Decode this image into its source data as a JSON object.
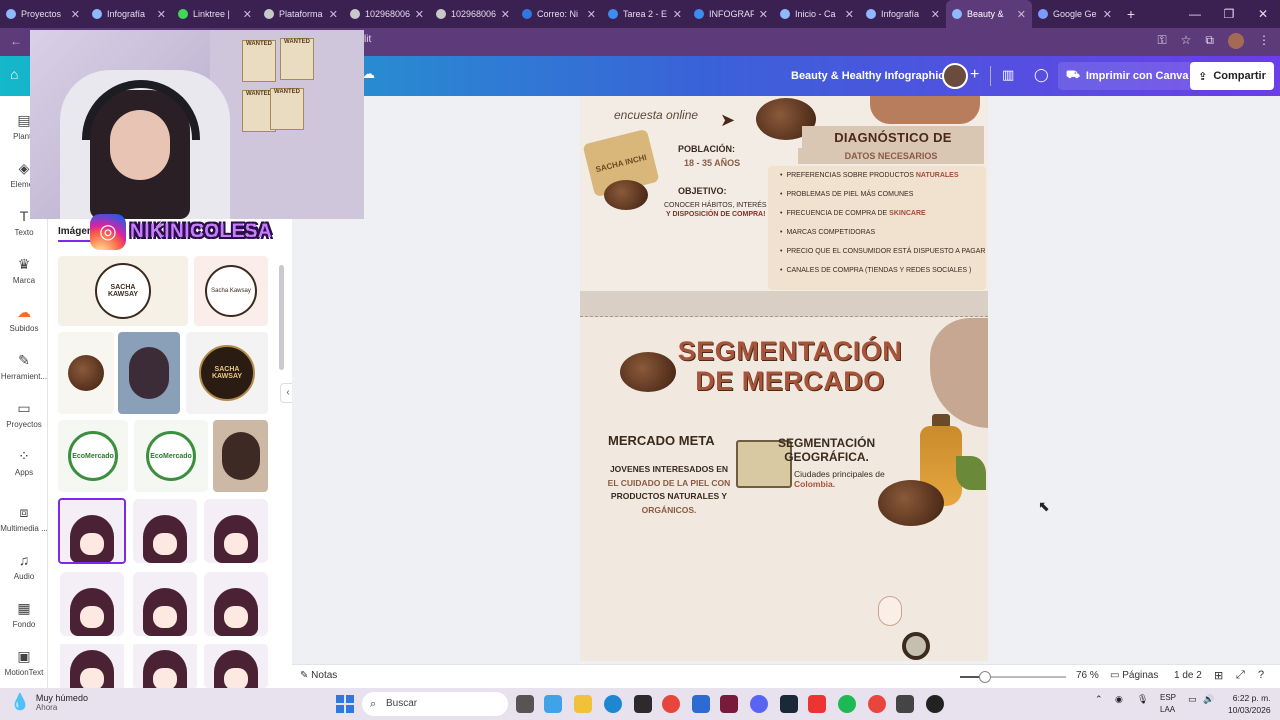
{
  "browser": {
    "tabs": [
      {
        "label": "Proyectos"
      },
      {
        "label": "Infografía"
      },
      {
        "label": "Linktree | "
      },
      {
        "label": "Plataforma"
      },
      {
        "label": "102968006"
      },
      {
        "label": "102968006"
      },
      {
        "label": "Correo: Ni"
      },
      {
        "label": "Tarea 2 - E"
      },
      {
        "label": "INFOGRAF"
      },
      {
        "label": "Inicio - Ca"
      },
      {
        "label": "Infografía"
      },
      {
        "label": "Beauty &"
      },
      {
        "label": "Google Ge"
      }
    ],
    "new_tab": "+",
    "address_fragment": "lit"
  },
  "canva": {
    "doc_title": "Beauty & Healthy Infographic",
    "print_button": "Imprimir con Canva",
    "share_button": "Compartir"
  },
  "rail": [
    {
      "label": "Plantil",
      "icon": "template-icon"
    },
    {
      "label": "Elemen",
      "icon": "elements-icon"
    },
    {
      "label": "Texto",
      "icon": "text-icon"
    },
    {
      "label": "Marca",
      "icon": "brand-icon"
    },
    {
      "label": "Subidos",
      "icon": "upload-icon"
    },
    {
      "label": "Herramient...",
      "icon": "tools-icon"
    },
    {
      "label": "Proyectos",
      "icon": "folder-icon"
    },
    {
      "label": "Apps",
      "icon": "apps-icon"
    },
    {
      "label": "Multimedia ...",
      "icon": "media-icon"
    },
    {
      "label": "Audio",
      "icon": "audio-icon"
    },
    {
      "label": "Fondo",
      "icon": "background-icon"
    },
    {
      "label": "MotionText",
      "icon": "motiontext-icon"
    }
  ],
  "panel": {
    "tab_images": "Imágen",
    "logos": {
      "sacha": "SACHA KAWSAY",
      "sacha_small": "Sacha Kawsay",
      "eco": "EcoMercado"
    }
  },
  "stream": {
    "instagram_handle": "NIKINICOLESA",
    "posters": [
      "WANTED",
      "WANTED",
      "WANTED",
      "WANTED"
    ]
  },
  "infographic": {
    "encuesta": "encuesta online",
    "diagnostico_title": "DIAGNÓSTICO DE MERCADO",
    "diagnostico_sub": "DATOS NECESARIOS",
    "poblacion_label": "POBLACIÓN:",
    "poblacion_value": "18 - 35 AÑOS",
    "objetivo_label": "OBJETIVO:",
    "objetivo_line1": "CONOCER HÁBITOS, INTERÉS",
    "objetivo_line2": "Y DISPOSICIÓN DE COMPRA!",
    "soap_text": "SACHA INCHI",
    "list": [
      {
        "text": "PREFERENCIAS SOBRE PRODUCTOS",
        "hl": "NATURALES"
      },
      {
        "text": "PROBLEMAS DE PIEL MÁS COMUNES",
        "hl": ""
      },
      {
        "text": "FRECUENCIA DE COMPRA DE",
        "hl": "SKINCARE"
      },
      {
        "text": "MARCAS COMPETIDORAS",
        "hl": ""
      },
      {
        "text": "PRECIO QUE EL CONSUMIDOR ESTÁ DISPUESTO A PAGAR",
        "hl": ""
      },
      {
        "text": "CANALES DE COMPRA (TIENDAS Y REDES SOCIALES )",
        "hl": ""
      }
    ],
    "seg_title_1": "SEGMENTACIÓN",
    "seg_title_2": "DE MERCADO",
    "meta_title": "MERCADO META",
    "meta_line1": "JOVENES INTERESADOS EN",
    "meta_line2": "EL CUIDADO DE LA PIEL CON",
    "meta_line3": "PRODUCTOS NATURALES Y",
    "meta_line4": "ORGÁNICOS.",
    "geo_title_1": "SEGMENTACIÓN",
    "geo_title_2": "GEOGRÁFICA.",
    "geo_line1": "Ciudades principales de",
    "geo_line2": "Colombia."
  },
  "statusbar": {
    "notes": "Notas",
    "zoom_percent": 76,
    "zoom_label": "76 %",
    "pages_label": "Páginas",
    "page_count": "1 de 2"
  },
  "taskbar": {
    "weather_line1": "Muy húmedo",
    "weather_line2": "Ahora",
    "search_placeholder": "Buscar",
    "lang_1": "ESP",
    "lang_2": "LAA",
    "time": "6:22 p. m.",
    "date": "10/03/2026"
  },
  "colors": {
    "tabbar": "#3b2152",
    "accent": "#7d2ae8",
    "infographic_brown": "#a8543a"
  }
}
